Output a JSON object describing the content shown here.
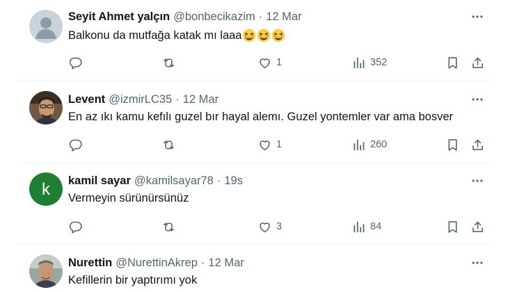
{
  "tweets": [
    {
      "name": "Seyit Ahmet yalçın",
      "handle": "@bonbecikazim",
      "separator": "·",
      "time": "12 Mar",
      "text": "Balkonu da mutfağa katak mı laaa",
      "emoji": "grinning-squinting-face",
      "likes": "1",
      "views": "352",
      "avatar": "default-avatar"
    },
    {
      "name": "Levent",
      "handle": "@izmirLC35",
      "separator": "·",
      "time": "12 Mar",
      "text": "En az ıkı kamu kefılı guzel bır hayal alemı. Guzel yontemler var ama bosver",
      "likes": "1",
      "views": "260",
      "avatar": "photo"
    },
    {
      "name": "kamil sayar",
      "handle": "@kamilsayar78",
      "separator": "·",
      "time": "19s",
      "text": "Vermeyin sürünürsünüz",
      "likes": "3",
      "views": "84",
      "avatar": "letter",
      "avatar_letter": "k",
      "avatar_color": "#1e7e34"
    },
    {
      "name": "Nurettin",
      "handle": "@NurettinAkrep",
      "separator": "·",
      "time": "12 Mar",
      "text": "Kefillerin bir yaptırımı yok",
      "avatar": "photo"
    }
  ],
  "colors": {
    "text": "#0f1419",
    "secondary": "#536471",
    "divider": "#eff3f4"
  },
  "icons": [
    "reply-icon",
    "retweet-icon",
    "like-icon",
    "views-icon",
    "bookmark-icon",
    "share-icon",
    "more-icon"
  ]
}
